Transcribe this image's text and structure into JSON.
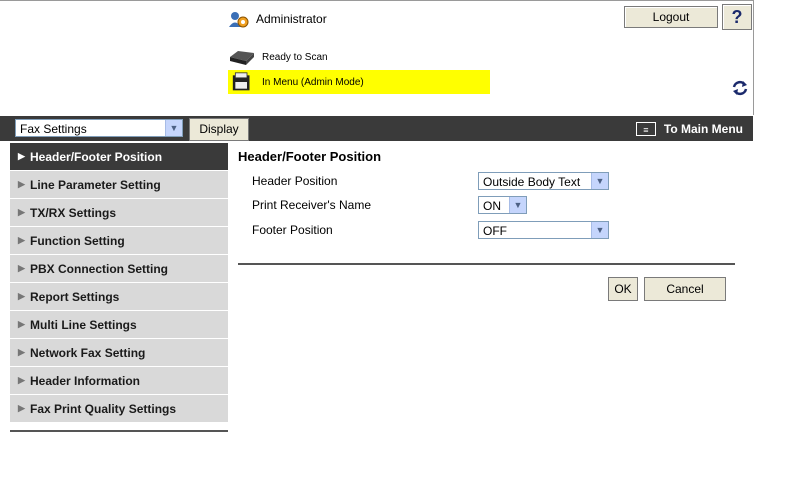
{
  "header": {
    "user_label": "Administrator",
    "logout_label": "Logout",
    "help_label": "?",
    "status_scan": "Ready to Scan",
    "status_menu": "In Menu (Admin Mode)"
  },
  "toolbar": {
    "category_selected": "Fax Settings",
    "display_label": "Display",
    "to_main_label": "To Main Menu"
  },
  "sidebar": {
    "items": [
      {
        "label": "Header/Footer Position"
      },
      {
        "label": "Line Parameter Setting"
      },
      {
        "label": "TX/RX Settings"
      },
      {
        "label": "Function Setting"
      },
      {
        "label": "PBX Connection Setting"
      },
      {
        "label": "Report Settings"
      },
      {
        "label": "Multi Line Settings"
      },
      {
        "label": "Network Fax Setting"
      },
      {
        "label": "Header Information"
      },
      {
        "label": "Fax Print Quality Settings"
      }
    ]
  },
  "main": {
    "title": "Header/Footer Position",
    "fields": [
      {
        "label": "Header Position",
        "value": "Outside Body Text"
      },
      {
        "label": "Print Receiver's Name",
        "value": "ON"
      },
      {
        "label": "Footer Position",
        "value": "OFF"
      }
    ],
    "ok_label": "OK",
    "cancel_label": "Cancel"
  },
  "colors": {
    "status_highlight": "#ffff00",
    "bar_background": "#3a3a3a",
    "sidebar_item_bg": "#d9d9d9"
  }
}
